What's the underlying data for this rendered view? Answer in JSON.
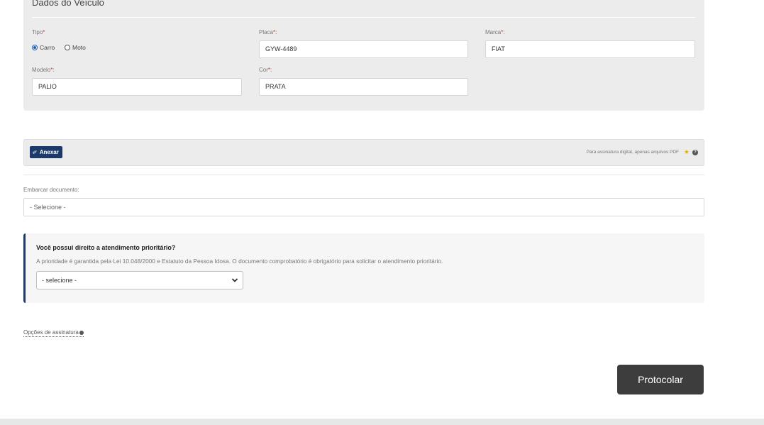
{
  "vehicle": {
    "title": "Dados do Veículo",
    "tipo_label": "Tipo",
    "tipo_req": "*",
    "options": {
      "carro": "Carro",
      "moto": "Moto"
    },
    "selected_tipo": "Carro",
    "placa_label": "Placa",
    "placa_req": "*:",
    "placa_value": "GYW-4489",
    "marca_label": "Marca",
    "marca_req": "*:",
    "marca_value": "FIAT",
    "modelo_label": "Modelo",
    "modelo_req": "*:",
    "modelo_value": "PALIO",
    "cor_label": "Cor",
    "cor_req": "*:",
    "cor_value": "PRATA"
  },
  "attach": {
    "button_label": "Anexar",
    "hint": "Para assinatura digital, apenas arquivos PDF",
    "help": "?"
  },
  "embed": {
    "label": "Embarcar documento:",
    "placeholder": "- Selecione -"
  },
  "priority": {
    "question": "Você possui direito a atendimento prioritário?",
    "description": "A prioridade é garantida pela Lei 10.048/2000 e Estatuto da Pessoa Idosa. O documento comprobatório é obrigatório para solicitar o atendimento prioritário.",
    "select_value": "- selecione -"
  },
  "signature_options": "Opções de assinatura",
  "submit_label": "Protocolar",
  "colors": {
    "accent": "#1b3a6b",
    "submit_bg": "#3d3d3d",
    "required": "#c0392b"
  }
}
